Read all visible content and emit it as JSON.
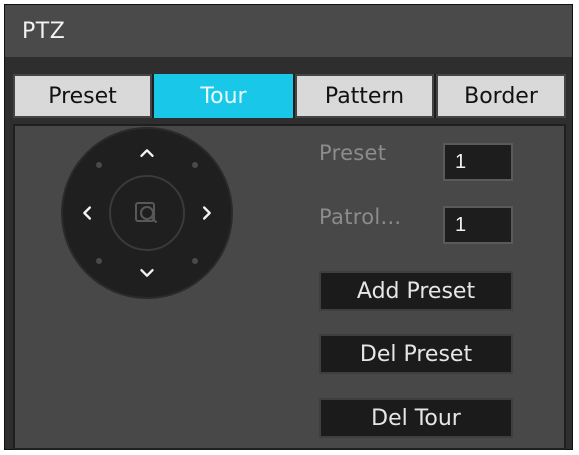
{
  "window": {
    "title": "PTZ"
  },
  "tabs": [
    {
      "label": "Preset",
      "active": false
    },
    {
      "label": "Tour",
      "active": true
    },
    {
      "label": "Pattern",
      "active": false
    },
    {
      "label": "Border",
      "active": false
    }
  ],
  "form": {
    "preset_label": "Preset",
    "preset_value": "1",
    "patrol_label": "Patrol...",
    "patrol_value": "1"
  },
  "buttons": {
    "add_preset": "Add Preset",
    "del_preset": "Del Preset",
    "del_tour": "Del Tour"
  },
  "joystick": {
    "up_icon": "chevron-up-icon",
    "down_icon": "chevron-down-icon",
    "left_icon": "chevron-left-icon",
    "right_icon": "chevron-right-icon",
    "center_icon": "magnifier-icon"
  },
  "colors": {
    "accent": "#19c7e8"
  }
}
